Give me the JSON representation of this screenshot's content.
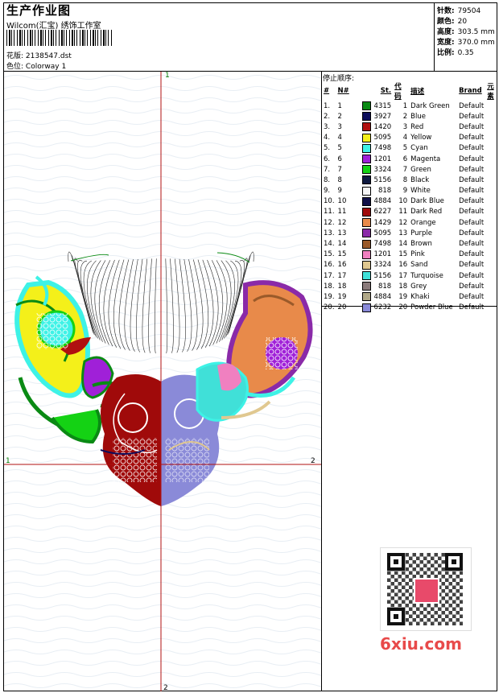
{
  "header": {
    "title": "生产作业图",
    "studio": "Wilcom(汇宝) 绣饰工作室",
    "design_file_label": "花版:",
    "design_file": "2138547.dst",
    "colorway_label": "色位:",
    "colorway": "Colorway 1"
  },
  "stats": {
    "stitches_label": "针数:",
    "stitches": "79504",
    "colors_label": "颜色:",
    "colors": "20",
    "height_label": "高度:",
    "height": "303.5 mm",
    "width_label": "宽度:",
    "width": "370.0 mm",
    "ratio_label": "比例:",
    "ratio": "0.35"
  },
  "stop_sequence": {
    "title": "停止顺序:",
    "columns": [
      "#",
      "N#",
      "St.",
      "代码",
      "描述",
      "Brand",
      "元素"
    ],
    "rows": [
      {
        "idx": "1.",
        "n": "1",
        "st": "4315",
        "code": "1",
        "desc": "Dark Green",
        "brand": "Default",
        "color": "#0a8a14"
      },
      {
        "idx": "2.",
        "n": "2",
        "st": "3927",
        "code": "2",
        "desc": "Blue",
        "brand": "Default",
        "color": "#0c0c5a"
      },
      {
        "idx": "3.",
        "n": "3",
        "st": "1420",
        "code": "3",
        "desc": "Red",
        "brand": "Default",
        "color": "#b01010"
      },
      {
        "idx": "4.",
        "n": "4",
        "st": "5095",
        "code": "4",
        "desc": "Yellow",
        "brand": "Default",
        "color": "#f4f01a"
      },
      {
        "idx": "5.",
        "n": "5",
        "st": "7498",
        "code": "5",
        "desc": "Cyan",
        "brand": "Default",
        "color": "#3ef2e6"
      },
      {
        "idx": "6.",
        "n": "6",
        "st": "1201",
        "code": "6",
        "desc": "Magenta",
        "brand": "Default",
        "color": "#a020d8"
      },
      {
        "idx": "7.",
        "n": "7",
        "st": "3324",
        "code": "7",
        "desc": "Green",
        "brand": "Default",
        "color": "#14d214"
      },
      {
        "idx": "8.",
        "n": "8",
        "st": "5156",
        "code": "8",
        "desc": "Black",
        "brand": "Default",
        "color": "#0e1a40"
      },
      {
        "idx": "9.",
        "n": "9",
        "st": "818",
        "code": "9",
        "desc": "White",
        "brand": "Default",
        "color": "#f6f6f6"
      },
      {
        "idx": "10.",
        "n": "10",
        "st": "4884",
        "code": "10",
        "desc": "Dark Blue",
        "brand": "Default",
        "color": "#101048"
      },
      {
        "idx": "11.",
        "n": "11",
        "st": "6227",
        "code": "11",
        "desc": "Dark Red",
        "brand": "Default",
        "color": "#a00a0a"
      },
      {
        "idx": "12.",
        "n": "12",
        "st": "1429",
        "code": "12",
        "desc": "Orange",
        "brand": "Default",
        "color": "#e88a4a"
      },
      {
        "idx": "13.",
        "n": "13",
        "st": "5095",
        "code": "13",
        "desc": "Purple",
        "brand": "Default",
        "color": "#8a2aa8"
      },
      {
        "idx": "14.",
        "n": "14",
        "st": "7498",
        "code": "14",
        "desc": "Brown",
        "brand": "Default",
        "color": "#9a5a2a"
      },
      {
        "idx": "15.",
        "n": "15",
        "st": "1201",
        "code": "15",
        "desc": "Pink",
        "brand": "Default",
        "color": "#f080c0"
      },
      {
        "idx": "16.",
        "n": "16",
        "st": "3324",
        "code": "16",
        "desc": "Sand",
        "brand": "Default",
        "color": "#e0c890"
      },
      {
        "idx": "17.",
        "n": "17",
        "st": "5156",
        "code": "17",
        "desc": "Turquoise",
        "brand": "Default",
        "color": "#40e0d8"
      },
      {
        "idx": "18.",
        "n": "18",
        "st": "818",
        "code": "18",
        "desc": "Grey",
        "brand": "Default",
        "color": "#8a7a7a"
      },
      {
        "idx": "19.",
        "n": "19",
        "st": "4884",
        "code": "19",
        "desc": "Khaki",
        "brand": "Default",
        "color": "#b0a888"
      },
      {
        "idx": "20.",
        "n": "20",
        "st": "6232",
        "code": "20",
        "desc": "Powder Blue",
        "brand": "Default",
        "color": "#8a8ad8"
      }
    ]
  },
  "axes": {
    "top_label": "1",
    "bottom_label": "2",
    "left_label": "1",
    "right_label": "2"
  },
  "watermark": "6xiu.com"
}
